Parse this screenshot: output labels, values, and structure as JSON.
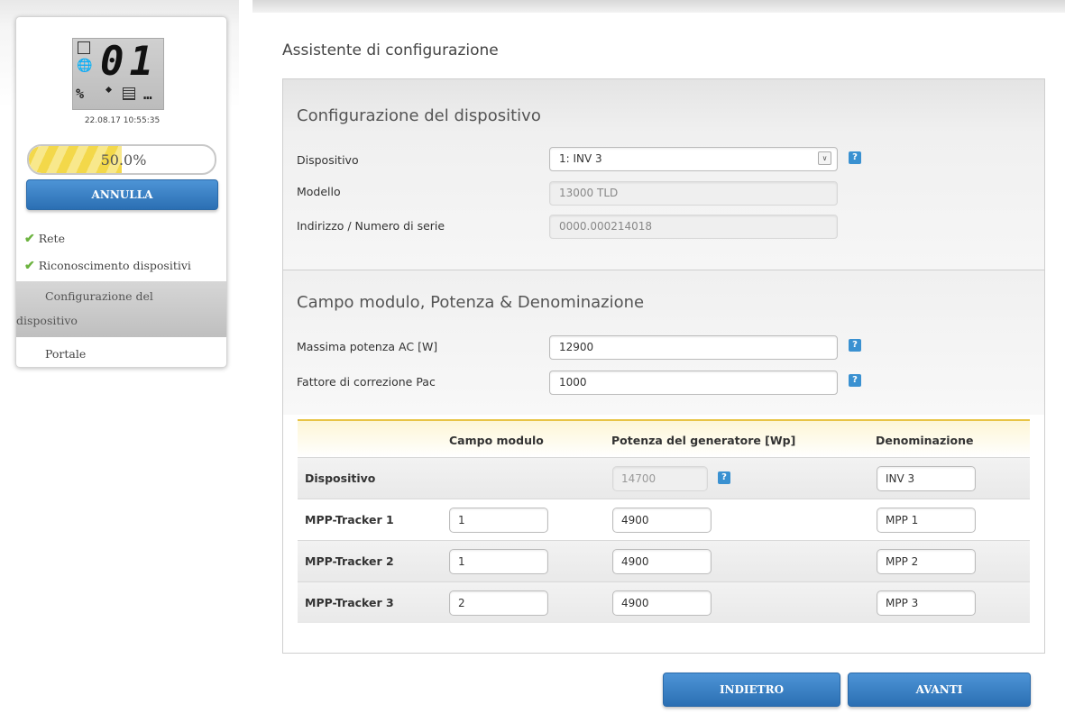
{
  "sidebar": {
    "lcd": {
      "digits": "01",
      "percent_symbol": "%",
      "dots": "…"
    },
    "timestamp": "22.08.17 10:55:35",
    "progress": {
      "value": 0.5,
      "label": "50.0%"
    },
    "cancel_label": "ANNULLA",
    "steps": [
      {
        "label": "Rete",
        "done": true
      },
      {
        "label": "Riconoscimento dispositivi",
        "done": true
      },
      {
        "label": "Configurazione del dispositivo",
        "label_line1": "Configurazione del",
        "label_line2": "dispositivo",
        "active": true
      },
      {
        "label": "Portale"
      }
    ]
  },
  "main": {
    "title": "Assistente di configurazione",
    "device_section": {
      "title": "Configurazione del dispositivo",
      "device_label": "Dispositivo",
      "device_value": "1: INV 3",
      "model_label": "Modello",
      "model_value": "13000 TLD",
      "serial_label": "Indirizzo / Numero di serie",
      "serial_value": "0000.000214018"
    },
    "power_section": {
      "title": "Campo modulo, Potenza & Denominazione",
      "max_ac_label": "Massima potenza AC [W]",
      "max_ac_value": "12900",
      "pac_factor_label": "Fattore di correzione Pac",
      "pac_factor_value": "1000"
    },
    "table": {
      "headers": [
        "Campo modulo",
        "Potenza del generatore [Wp]",
        "Denominazione"
      ],
      "device_row": {
        "label": "Dispositivo",
        "power": "14700",
        "name": "INV 3"
      },
      "trackers": [
        {
          "label": "MPP-Tracker 1",
          "field": "1",
          "power": "4900",
          "name": "MPP 1"
        },
        {
          "label": "MPP-Tracker 2",
          "field": "1",
          "power": "4900",
          "name": "MPP 2"
        },
        {
          "label": "MPP-Tracker 3",
          "field": "2",
          "power": "4900",
          "name": "MPP 3"
        }
      ]
    },
    "help_glyph": "?",
    "back_label": "INDIETRO",
    "next_label": "AVANTI"
  }
}
